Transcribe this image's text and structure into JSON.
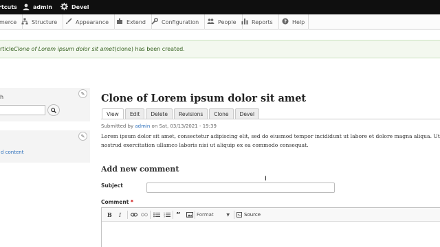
{
  "adminbar": {
    "shortcuts_label": "rtcuts",
    "user_label": "admin",
    "devel_label": "Devel"
  },
  "tray": {
    "items": [
      {
        "label": "merce",
        "icon": "commerce-icon"
      },
      {
        "label": "Structure",
        "icon": "structure-icon"
      },
      {
        "label": "Appearance",
        "icon": "appearance-icon"
      },
      {
        "label": "Extend",
        "icon": "extend-icon"
      },
      {
        "label": "Configuration",
        "icon": "wrench-icon"
      },
      {
        "label": "People",
        "icon": "people-icon"
      },
      {
        "label": "Reports",
        "icon": "reports-icon"
      },
      {
        "label": "Help",
        "icon": "help-icon"
      }
    ]
  },
  "status": {
    "prefix": "rticle ",
    "node_title": "Clone of Lorem ipsum dolor sit amet",
    "suffix": " (clone) has been created."
  },
  "sidebar": {
    "search_title": "h",
    "tools_title": "",
    "tools_link": "d content"
  },
  "node": {
    "title": "Clone of Lorem ipsum dolor sit amet",
    "tabs": [
      "View",
      "Edit",
      "Delete",
      "Revisions",
      "Clone",
      "Devel"
    ],
    "submitted_prefix": "Submitted by ",
    "submitted_author": "admin",
    "submitted_suffix": " on Sat, 03/13/2021 - 19:39",
    "body_line1": "Lorem ipsum dolor sit amet, consectetur adipiscing elit, sed do eiusmod tempor incididunt ut labore et dolore magna aliqua. Ut enim ad minim venian",
    "body_line2": "nostrud exercitation ullamco laboris nisi ut aliquip ex ea commodo consequat."
  },
  "comment": {
    "heading": "Add new comment",
    "subject_label": "Subject",
    "comment_label": "Comment",
    "required_marker": "*",
    "toolbar": {
      "format_label": "Format",
      "source_label": "Source"
    }
  },
  "colors": {
    "adminbar_bg": "#0f0f0f",
    "status_bg": "#f3f8ef",
    "status_text": "#325e1c",
    "link": "#2a6ebb"
  }
}
